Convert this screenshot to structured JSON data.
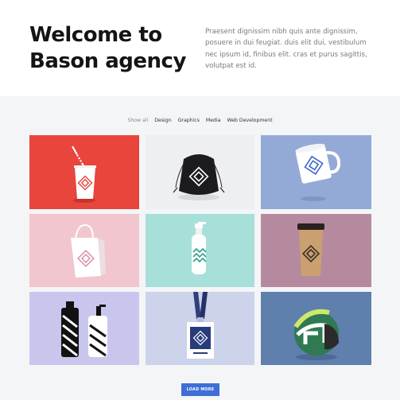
{
  "hero": {
    "title": "Welcome to Bason agency",
    "text": "Praesent dignissim nibh quis ante dignissim, posuere in dui feugiat. duis elit dui, vestibulum nec ipsum id, finibus elit. cras et purus sagittis, volutpat est id."
  },
  "filters": [
    "Show all",
    "Design",
    "Graphics",
    "Media",
    "Web Development"
  ],
  "portfolio": [
    {
      "item": "paper-cup",
      "bg": "#e8453c"
    },
    {
      "item": "drawstring-bag",
      "bg": "#eeeff1"
    },
    {
      "item": "mug",
      "bg": "#93aad6"
    },
    {
      "item": "shopping-bag",
      "bg": "#f2c6cf"
    },
    {
      "item": "pump-bottle",
      "bg": "#a7e0d8"
    },
    {
      "item": "coffee-cup",
      "bg": "#b68a9e"
    },
    {
      "item": "bottles",
      "bg": "#c9c6ee"
    },
    {
      "item": "id-badge",
      "bg": "#ccd3ea"
    },
    {
      "item": "helmet",
      "bg": "#5f7fad"
    }
  ],
  "button": {
    "label": "LOAD MORE"
  }
}
